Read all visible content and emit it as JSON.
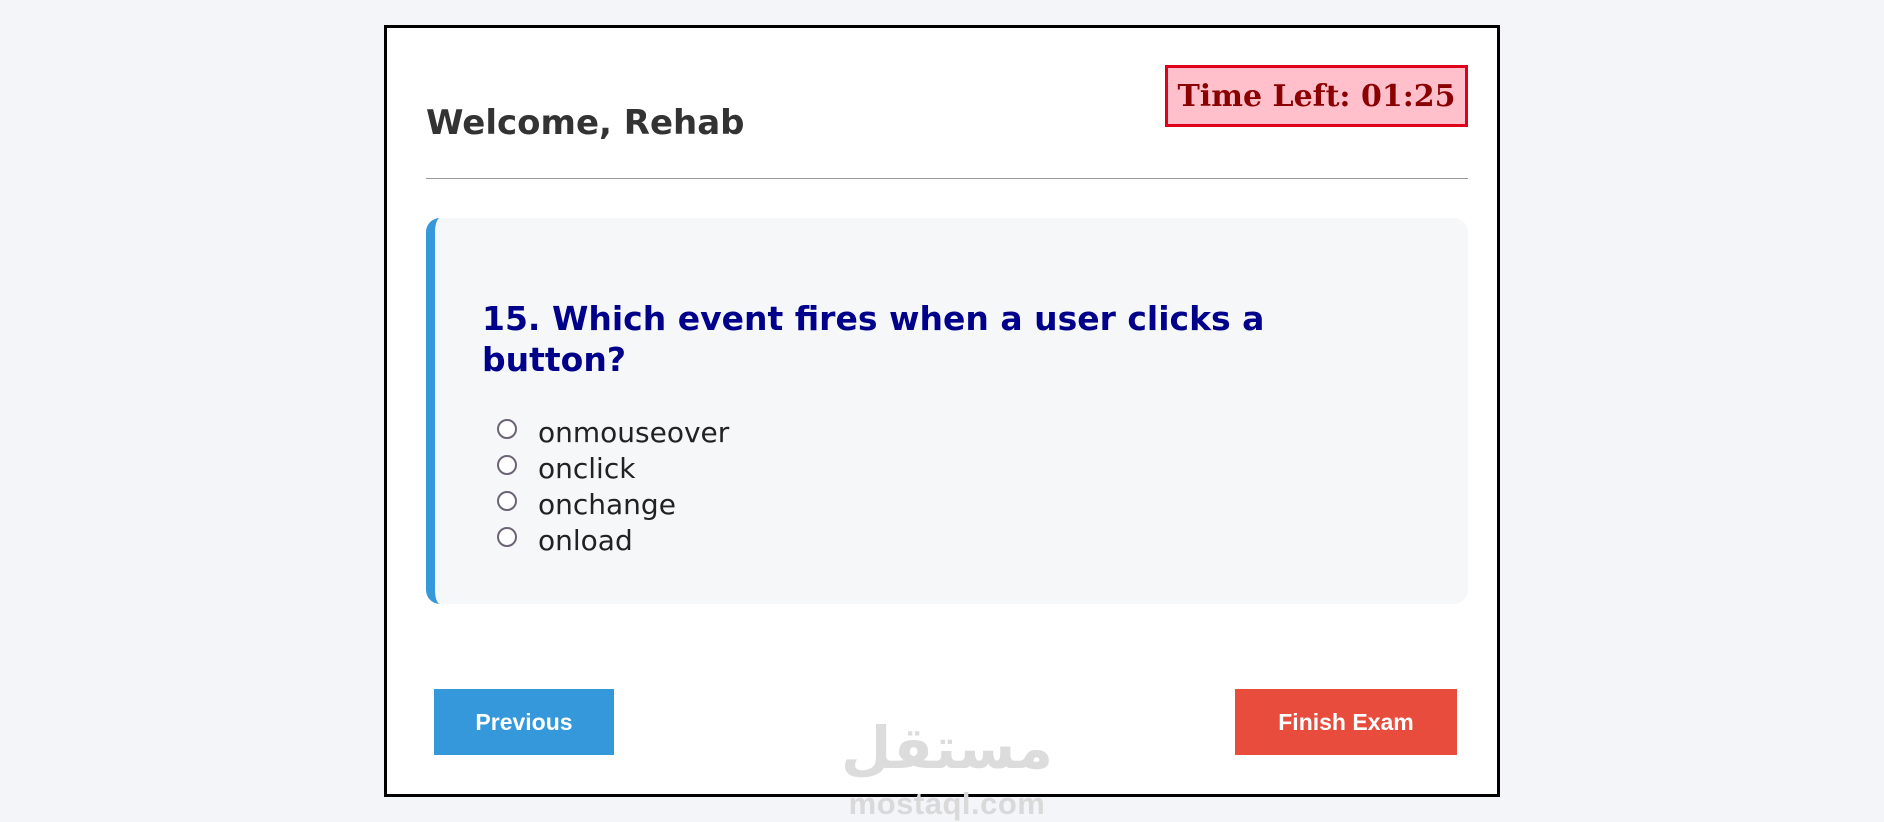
{
  "header": {
    "welcome_text": "Welcome, Rehab",
    "timer_text": "Time Left: 01:25"
  },
  "question": {
    "text": "15. Which event fires when a user clicks a button?",
    "options": [
      "onmouseover",
      "onclick",
      "onchange",
      "onload"
    ]
  },
  "buttons": {
    "previous_label": "Previous",
    "finish_label": "Finish Exam"
  },
  "watermark": {
    "arabic_text": "مستقل",
    "domain_text": "mostaql.com"
  },
  "colors": {
    "page_background": "#f4f5f9",
    "timer_background": "#ffc0cb",
    "timer_border": "#e0001b",
    "timer_text": "#8b0000",
    "question_accent": "#3498db",
    "question_text": "#00008b",
    "previous_button": "#3498db",
    "finish_button": "#e74c3c"
  }
}
